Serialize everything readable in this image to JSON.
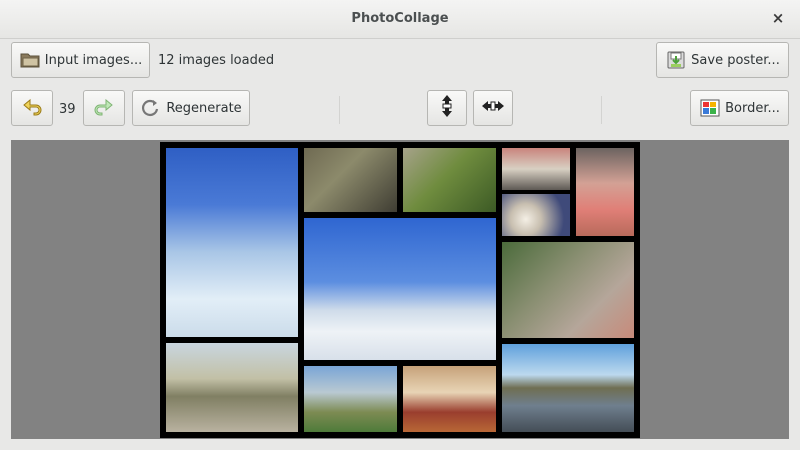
{
  "window": {
    "title": "PhotoCollage",
    "close_glyph": "×"
  },
  "toolbar1": {
    "input_label": "Input images...",
    "status": "12 images loaded",
    "save_label": "Save poster..."
  },
  "toolbar2": {
    "history_count": "39",
    "regenerate_label": "Regenerate",
    "border_label": "Border..."
  },
  "icons": [
    "folder-icon",
    "save-icon",
    "undo-icon",
    "redo-icon",
    "refresh-icon",
    "vertical-resize-icon",
    "horizontal-resize-icon",
    "color-palette-icon",
    "close-icon"
  ],
  "colors": {
    "accent_yellow": "#e5c84a",
    "accent_green": "#8fd184",
    "canvas": "#828282",
    "poster_bg": "#000000"
  }
}
